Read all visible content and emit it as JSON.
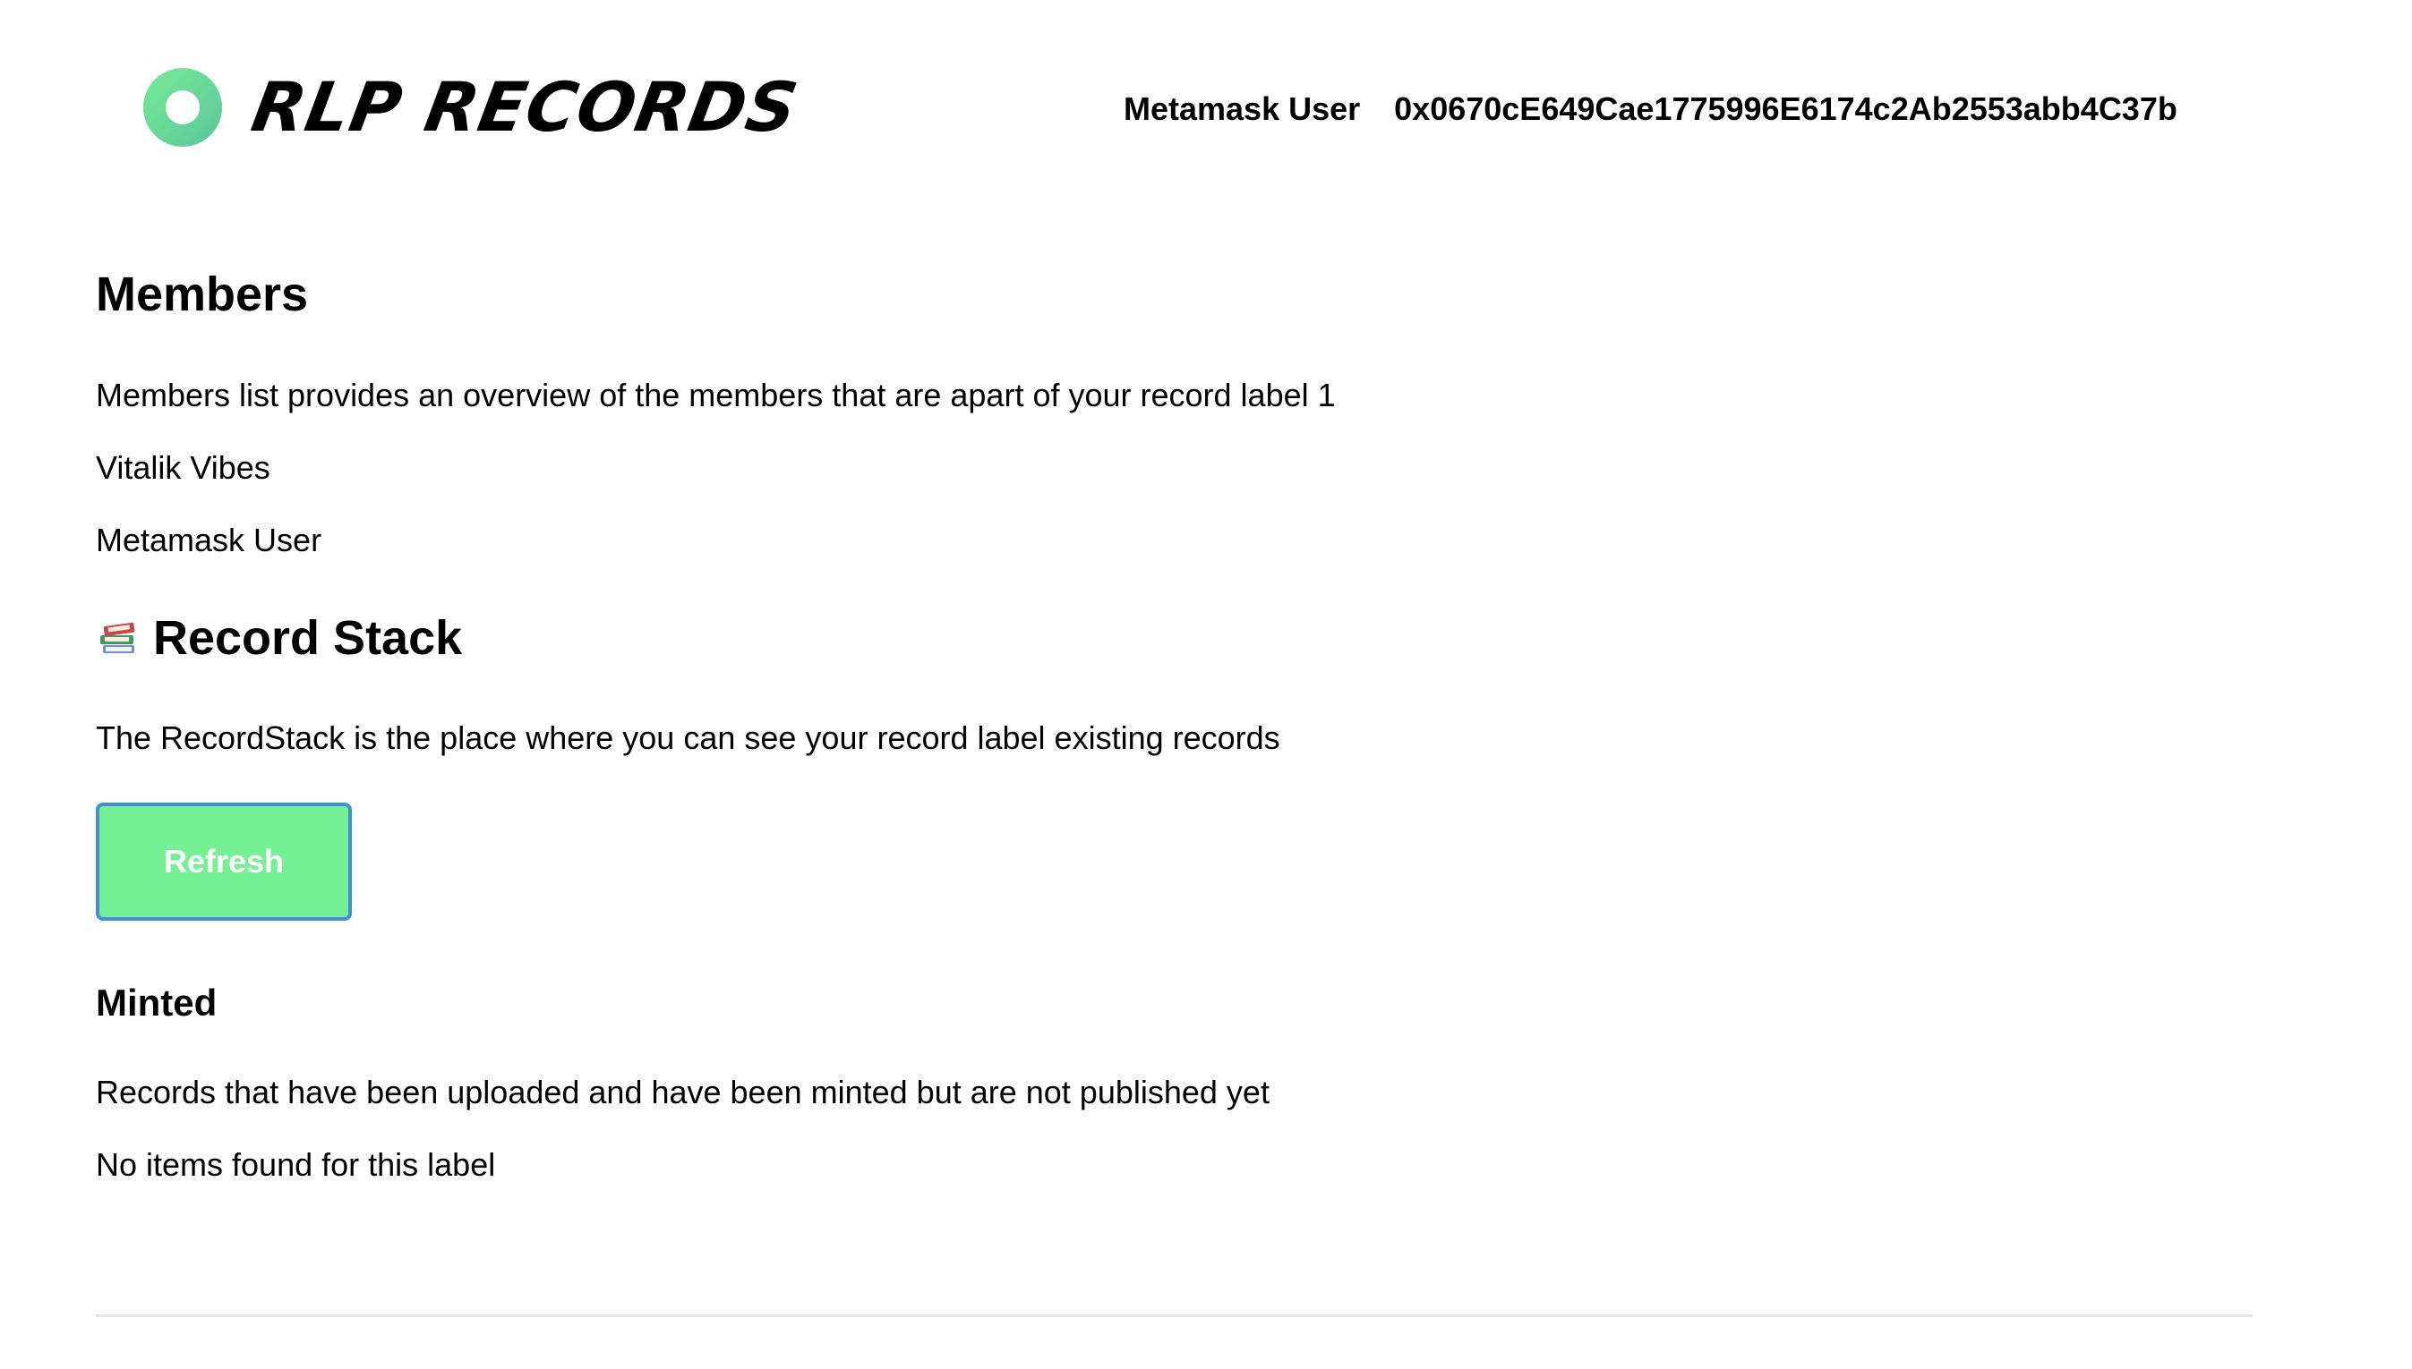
{
  "header": {
    "logo_text": "RLP RECORDS",
    "account_name": "Metamask User",
    "wallet_address": "0x0670cE649Cae1775996E6174c2Ab2553abb4C37b"
  },
  "members": {
    "title": "Members",
    "description": "Members list provides an overview of the members that are apart of your record label 1",
    "items": [
      "Vitalik Vibes",
      "Metamask User"
    ]
  },
  "record_stack": {
    "icon": "books-icon",
    "title": "Record Stack",
    "description": "The RecordStack is the place where you can see your record label existing records",
    "refresh_label": "Refresh"
  },
  "minted": {
    "title": "Minted",
    "description": "Records that have been uploaded and have been minted but are not published yet",
    "empty_message": "No items found for this label"
  },
  "colors": {
    "logo_gradient_start": "#74ec95",
    "logo_gradient_end": "#5dc59c",
    "refresh_background": "#75f095",
    "refresh_border": "#418fd7",
    "divider": "#e4e4e4"
  }
}
